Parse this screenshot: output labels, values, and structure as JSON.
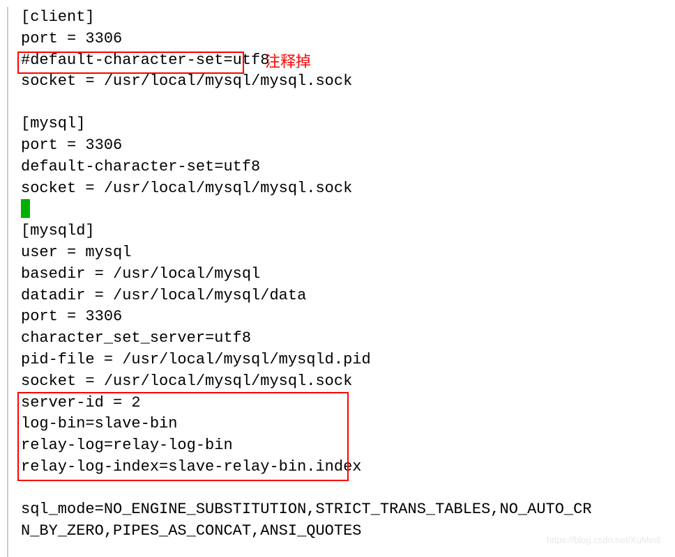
{
  "client": {
    "section": "[client]",
    "port": "port = 3306",
    "default_charset": "#default-character-set=utf8",
    "socket": "socket = /usr/local/mysql/mysql.sock"
  },
  "mysql": {
    "section": "[mysql]",
    "port": "port = 3306",
    "default_charset": "default-character-set=utf8",
    "socket": "socket = /usr/local/mysql/mysql.sock"
  },
  "mysqld": {
    "section": "[mysqld]",
    "user": "user = mysql",
    "basedir": "basedir = /usr/local/mysql",
    "datadir": "datadir = /usr/local/mysql/data",
    "port": "port = 3306",
    "charset_server": "character_set_server=utf8",
    "pid_file": "pid-file = /usr/local/mysql/mysqld.pid",
    "socket": "socket = /usr/local/mysql/mysql.sock",
    "server_id": "server-id = 2",
    "log_bin": "log-bin=slave-bin",
    "relay_log": "relay-log=relay-log-bin",
    "relay_log_index": "relay-log-index=slave-relay-bin.index",
    "sql_mode_line1": "sql_mode=NO_ENGINE_SUBSTITUTION,STRICT_TRANS_TABLES,NO_AUTO_CR",
    "sql_mode_line2": "N_BY_ZERO,PIPES_AS_CONCAT,ANSI_QUOTES"
  },
  "annotations": {
    "comment_out": "注释掉"
  },
  "watermark": "https://blog.csdn.net/XuMin6"
}
